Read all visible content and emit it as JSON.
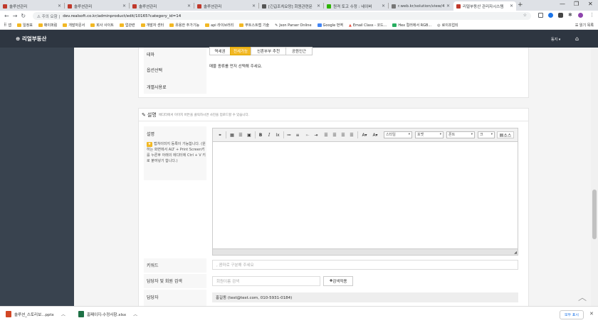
{
  "browser": {
    "tabs": [
      {
        "title": "솔루션관리",
        "color": "#c0392b"
      },
      {
        "title": "솔루션관리",
        "color": "#c0392b"
      },
      {
        "title": "솔루션관리",
        "color": "#c0392b"
      },
      {
        "title": "솔루션관리",
        "color": "#c0392b"
      },
      {
        "title": "[긴급조치요망] 회원관련문",
        "color": "#555555"
      },
      {
        "title": "원격 토고 수정 : 네이버",
        "color": "#2db400"
      },
      {
        "title": "r.web.kr/solution/view/4",
        "color": "#777777"
      },
      {
        "title": "리얼부동산 관리자시스템",
        "color": "#c0392b"
      }
    ],
    "new_tab": "+",
    "url_prefix": "주의 요함",
    "url": "dev.realsoft.co.kr/adminproduct/edit/10165?category_id=14",
    "bookmarks": [
      "앱",
      "일정표",
      "매이퍼럼",
      "개발자문서",
      "회사 사이트",
      "업관련",
      "개발자 센터",
      "유용한 추가기능",
      "api 라이브러리",
      "부트스트랩 기술",
      "Json Parser Online",
      "Google 번역",
      "Email Class - 코드...",
      "Hex 컬러에서 RGB...",
      "로이조업되"
    ],
    "reading_list": "읽기 목록"
  },
  "app": {
    "brand": "리얼부동산",
    "user": "동지",
    "home_icon": "home-icon"
  },
  "form": {
    "theme_label": "테마",
    "theme_options": [
      "역세권",
      "전세가능",
      "신혼부부 추천",
      "공원인근"
    ],
    "theme_selected_index": 1,
    "option_label": "옵션선택",
    "option_value": "매물 종류를 먼저 선택해 주세요.",
    "individual_label": "개별사용료",
    "desc_section_title": "설명",
    "desc_section_sub": "에디터에서 이미지 버튼을 클릭하시면 사진을 업로드할 수 있습니다.",
    "desc_label": "설명",
    "desc_tip": "캡쳐이미지 등록이 가능합니다. (원하는 화면에서 ALT + Print Screen키를 누른후 아래의 에디터에 Ctrl + V 키로 붙여넣기 합니다.)",
    "editor": {
      "combos": [
        "스타일",
        "포맷",
        "폰트",
        "크"
      ],
      "source_label": "소스"
    },
    "keyword_label": "키워드",
    "keyword_placeholder": ", 콤마로 구분해 주세요",
    "manager_search_label": "담당자 및 회원 검색",
    "manager_search_placeholder": "회원이름 검색",
    "search_button": "검색적용",
    "manager_label": "담당자",
    "manager_value": "홍길동 (test@test.com, 010-5931-0184)"
  },
  "downloads": {
    "items": [
      {
        "name": "솔루션_스토리보...pptx",
        "color": "#d24726"
      },
      {
        "name": "홈페이지-수정사항.xlsx",
        "color": "#1e7145"
      }
    ],
    "show_all": "모두 표시"
  }
}
